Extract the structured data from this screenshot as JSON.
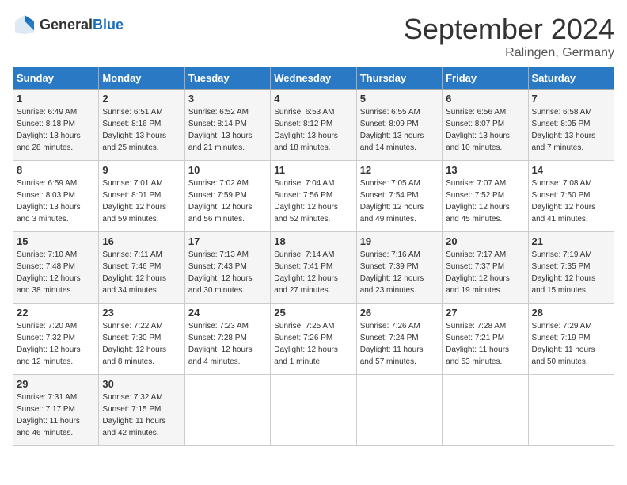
{
  "header": {
    "logo": {
      "text1": "General",
      "text2": "Blue"
    },
    "title": "September 2024",
    "location": "Ralingen, Germany"
  },
  "weekdays": [
    "Sunday",
    "Monday",
    "Tuesday",
    "Wednesday",
    "Thursday",
    "Friday",
    "Saturday"
  ],
  "weeks": [
    [
      {
        "day": "1",
        "info": "Sunrise: 6:49 AM\nSunset: 8:18 PM\nDaylight: 13 hours\nand 28 minutes."
      },
      {
        "day": "2",
        "info": "Sunrise: 6:51 AM\nSunset: 8:16 PM\nDaylight: 13 hours\nand 25 minutes."
      },
      {
        "day": "3",
        "info": "Sunrise: 6:52 AM\nSunset: 8:14 PM\nDaylight: 13 hours\nand 21 minutes."
      },
      {
        "day": "4",
        "info": "Sunrise: 6:53 AM\nSunset: 8:12 PM\nDaylight: 13 hours\nand 18 minutes."
      },
      {
        "day": "5",
        "info": "Sunrise: 6:55 AM\nSunset: 8:09 PM\nDaylight: 13 hours\nand 14 minutes."
      },
      {
        "day": "6",
        "info": "Sunrise: 6:56 AM\nSunset: 8:07 PM\nDaylight: 13 hours\nand 10 minutes."
      },
      {
        "day": "7",
        "info": "Sunrise: 6:58 AM\nSunset: 8:05 PM\nDaylight: 13 hours\nand 7 minutes."
      }
    ],
    [
      {
        "day": "8",
        "info": "Sunrise: 6:59 AM\nSunset: 8:03 PM\nDaylight: 13 hours\nand 3 minutes."
      },
      {
        "day": "9",
        "info": "Sunrise: 7:01 AM\nSunset: 8:01 PM\nDaylight: 12 hours\nand 59 minutes."
      },
      {
        "day": "10",
        "info": "Sunrise: 7:02 AM\nSunset: 7:59 PM\nDaylight: 12 hours\nand 56 minutes."
      },
      {
        "day": "11",
        "info": "Sunrise: 7:04 AM\nSunset: 7:56 PM\nDaylight: 12 hours\nand 52 minutes."
      },
      {
        "day": "12",
        "info": "Sunrise: 7:05 AM\nSunset: 7:54 PM\nDaylight: 12 hours\nand 49 minutes."
      },
      {
        "day": "13",
        "info": "Sunrise: 7:07 AM\nSunset: 7:52 PM\nDaylight: 12 hours\nand 45 minutes."
      },
      {
        "day": "14",
        "info": "Sunrise: 7:08 AM\nSunset: 7:50 PM\nDaylight: 12 hours\nand 41 minutes."
      }
    ],
    [
      {
        "day": "15",
        "info": "Sunrise: 7:10 AM\nSunset: 7:48 PM\nDaylight: 12 hours\nand 38 minutes."
      },
      {
        "day": "16",
        "info": "Sunrise: 7:11 AM\nSunset: 7:46 PM\nDaylight: 12 hours\nand 34 minutes."
      },
      {
        "day": "17",
        "info": "Sunrise: 7:13 AM\nSunset: 7:43 PM\nDaylight: 12 hours\nand 30 minutes."
      },
      {
        "day": "18",
        "info": "Sunrise: 7:14 AM\nSunset: 7:41 PM\nDaylight: 12 hours\nand 27 minutes."
      },
      {
        "day": "19",
        "info": "Sunrise: 7:16 AM\nSunset: 7:39 PM\nDaylight: 12 hours\nand 23 minutes."
      },
      {
        "day": "20",
        "info": "Sunrise: 7:17 AM\nSunset: 7:37 PM\nDaylight: 12 hours\nand 19 minutes."
      },
      {
        "day": "21",
        "info": "Sunrise: 7:19 AM\nSunset: 7:35 PM\nDaylight: 12 hours\nand 15 minutes."
      }
    ],
    [
      {
        "day": "22",
        "info": "Sunrise: 7:20 AM\nSunset: 7:32 PM\nDaylight: 12 hours\nand 12 minutes."
      },
      {
        "day": "23",
        "info": "Sunrise: 7:22 AM\nSunset: 7:30 PM\nDaylight: 12 hours\nand 8 minutes."
      },
      {
        "day": "24",
        "info": "Sunrise: 7:23 AM\nSunset: 7:28 PM\nDaylight: 12 hours\nand 4 minutes."
      },
      {
        "day": "25",
        "info": "Sunrise: 7:25 AM\nSunset: 7:26 PM\nDaylight: 12 hours\nand 1 minute."
      },
      {
        "day": "26",
        "info": "Sunrise: 7:26 AM\nSunset: 7:24 PM\nDaylight: 11 hours\nand 57 minutes."
      },
      {
        "day": "27",
        "info": "Sunrise: 7:28 AM\nSunset: 7:21 PM\nDaylight: 11 hours\nand 53 minutes."
      },
      {
        "day": "28",
        "info": "Sunrise: 7:29 AM\nSunset: 7:19 PM\nDaylight: 11 hours\nand 50 minutes."
      }
    ],
    [
      {
        "day": "29",
        "info": "Sunrise: 7:31 AM\nSunset: 7:17 PM\nDaylight: 11 hours\nand 46 minutes."
      },
      {
        "day": "30",
        "info": "Sunrise: 7:32 AM\nSunset: 7:15 PM\nDaylight: 11 hours\nand 42 minutes."
      },
      {
        "day": "",
        "info": ""
      },
      {
        "day": "",
        "info": ""
      },
      {
        "day": "",
        "info": ""
      },
      {
        "day": "",
        "info": ""
      },
      {
        "day": "",
        "info": ""
      }
    ]
  ]
}
